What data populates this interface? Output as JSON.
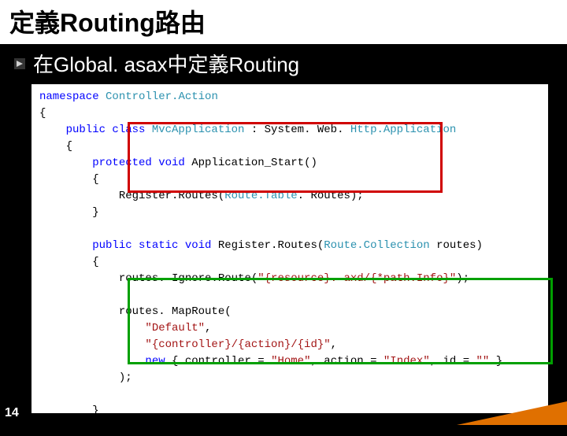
{
  "title": "定義Routing路由",
  "bullet": "在Global. asax中定義Routing",
  "page_number": "14",
  "code": {
    "l1_kw": "namespace",
    "l1_type": " Controller.Action",
    "l2": "{",
    "l3_kw": "    public class",
    "l3_type": " MvcApplication",
    "l3_plain": " : System. Web. ",
    "l3_type2": "Http.Application",
    "l4": "    {",
    "l5_kw": "        protected void",
    "l5_plain": " Application_Start()",
    "l6": "        {",
    "l7_plain": "            Register.Routes(",
    "l7_type": "Route.Table",
    "l7_plain2": ". Routes);",
    "l8": "        }",
    "l10_kw": "        public static void",
    "l10_plain": " Register.Routes(",
    "l10_type": "Route.Collection",
    "l10_plain2": " routes)",
    "l11": "        {",
    "l12_plain": "            routes. Ignore.Route(",
    "l12_str": "\"{resource}. axd/{*path.Info}\"",
    "l12_plain2": ");",
    "l14_plain": "            routes. MapRoute(",
    "l15_str": "                \"Default\"",
    "l15_plain": ",",
    "l16_str": "                \"{controller}/{action}/{id}\"",
    "l16_plain": ",",
    "l17_kw": "                new",
    "l17_plain": " { controller = ",
    "l17_str": "\"Home\"",
    "l17_plain2": ", action = ",
    "l17_str2": "\"Index\"",
    "l17_plain3": ", id = ",
    "l17_str3": "\"\"",
    "l17_plain4": " }",
    "l18_plain": "            );",
    "l20": "        }",
    "l21": "    }"
  }
}
